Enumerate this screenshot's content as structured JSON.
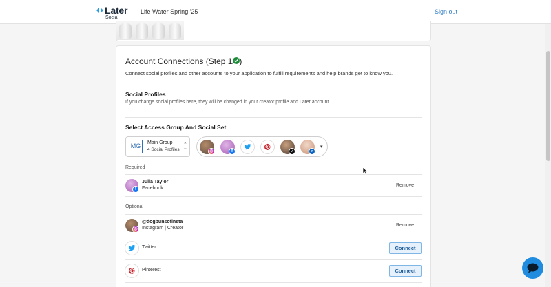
{
  "header": {
    "logo_word": "Later",
    "logo_sub": "Social",
    "campaign": "Life Water Spring '25",
    "signout_label": "Sign out"
  },
  "step": {
    "title": "Account Connections (Step 1/4)",
    "description": "Connect social profiles and other accounts to your application to fulfill requirements and help brands get to know you."
  },
  "social_profiles": {
    "heading": "Social Profiles",
    "note": "If you change social profiles here, they will be changed in your creator profile and Later account."
  },
  "access_group": {
    "heading": "Select Access Group And Social Set",
    "badge": "MG",
    "group_name": "Main Group",
    "group_count": "4 Social Profiles",
    "profile_icons": [
      "instagram-icon",
      "facebook-icon",
      "twitter-icon",
      "pinterest-icon",
      "tiktok-icon",
      "linkedin-icon"
    ]
  },
  "required": {
    "label": "Required",
    "rows": [
      {
        "name": "Julia Taylor",
        "platform": "Facebook",
        "action": "Remove"
      }
    ]
  },
  "optional": {
    "label": "Optional",
    "rows": [
      {
        "name": "@dogbunsofinsta",
        "platform": "Instagram | Creator",
        "action": "Remove"
      },
      {
        "name": "Twitter",
        "action": "Connect"
      },
      {
        "name": "Pinterest",
        "action": "Connect"
      }
    ]
  },
  "colors": {
    "accent_blue": "#2f7ec7",
    "success_green": "#1d8c3a",
    "chat_blue": "#1f8ce0"
  }
}
